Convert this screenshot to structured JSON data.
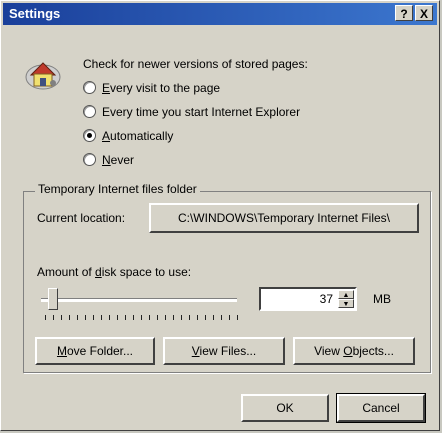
{
  "window": {
    "title": "Settings",
    "help_label": "?",
    "close_label": "X"
  },
  "check": {
    "heading": "Check for newer versions of stored pages:",
    "options": [
      {
        "mnemonic": "E",
        "rest": "very visit to the page",
        "selected": false
      },
      {
        "mnemonic": "",
        "rest": "Every time you start Internet Explorer",
        "selected": false
      },
      {
        "mnemonic": "A",
        "rest": "utomatically",
        "selected": true
      },
      {
        "mnemonic": "N",
        "rest": "ever",
        "selected": false
      }
    ]
  },
  "temp_folder": {
    "group_title": "Temporary Internet files folder",
    "current_location_label": "Current location:",
    "current_location_value": "C:\\WINDOWS\\Temporary Internet Files\\",
    "disk_space_label_pre": "Amount of ",
    "disk_space_mnemonic": "d",
    "disk_space_label_post": "isk space to use:",
    "disk_space_value": "37",
    "disk_space_unit": "MB",
    "slider_fraction": 0.06,
    "buttons": [
      {
        "mnemonic": "M",
        "rest": "ove Folder..."
      },
      {
        "mnemonic": "V",
        "rest": "iew Files..."
      },
      {
        "pre": "View ",
        "mnemonic": "O",
        "rest": "bjects..."
      }
    ]
  },
  "footer": {
    "ok_label": "OK",
    "cancel_label": "Cancel"
  },
  "icons": [
    "settings-house-icon",
    "help-icon",
    "close-icon"
  ]
}
